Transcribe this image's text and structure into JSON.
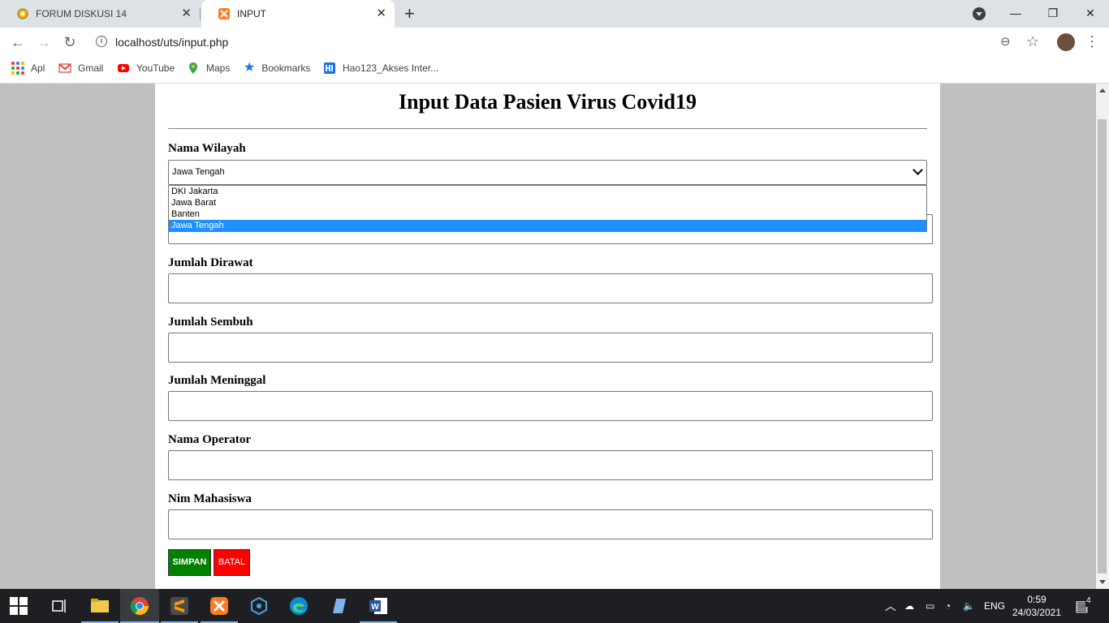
{
  "browser": {
    "tabs": [
      {
        "title": "FORUM DISKUSI 14",
        "icon": "forum-favicon"
      },
      {
        "title": "INPUT",
        "icon": "xampp-favicon",
        "active": true
      }
    ],
    "url": "localhost/uts/input.php",
    "bookmarks": [
      {
        "label": "Apl",
        "icon": "apps-grid-icon"
      },
      {
        "label": "Gmail",
        "icon": "gmail-icon"
      },
      {
        "label": "YouTube",
        "icon": "youtube-icon"
      },
      {
        "label": "Maps",
        "icon": "maps-icon"
      },
      {
        "label": "Bookmarks",
        "icon": "star-icon"
      },
      {
        "label": "Hao123_Akses Inter...",
        "icon": "hao123-icon"
      }
    ]
  },
  "form": {
    "title": "Input Data Pasien Virus Covid19",
    "wilayah_label": "Nama Wilayah",
    "wilayah_selected": "Jawa Tengah",
    "wilayah_options": [
      "DKI Jakarta",
      "Jawa Barat",
      "Banten",
      "Jawa Tengah"
    ],
    "fields": [
      {
        "label": "Jumlah Dirawat",
        "value": ""
      },
      {
        "label": "Jumlah Sembuh",
        "value": ""
      },
      {
        "label": "Jumlah Meninggal",
        "value": ""
      },
      {
        "label": "Nama Operator",
        "value": ""
      },
      {
        "label": "Nim Mahasiswa",
        "value": ""
      }
    ],
    "save_label": "SIMPAN",
    "cancel_label": "BATAL",
    "colors": {
      "save": "#008000",
      "cancel": "#ff0000",
      "selected_option": "#1e90ff"
    }
  },
  "taskbar": {
    "language": "ENG",
    "time": "0:59",
    "date": "24/03/2021",
    "notification_count": "4"
  }
}
